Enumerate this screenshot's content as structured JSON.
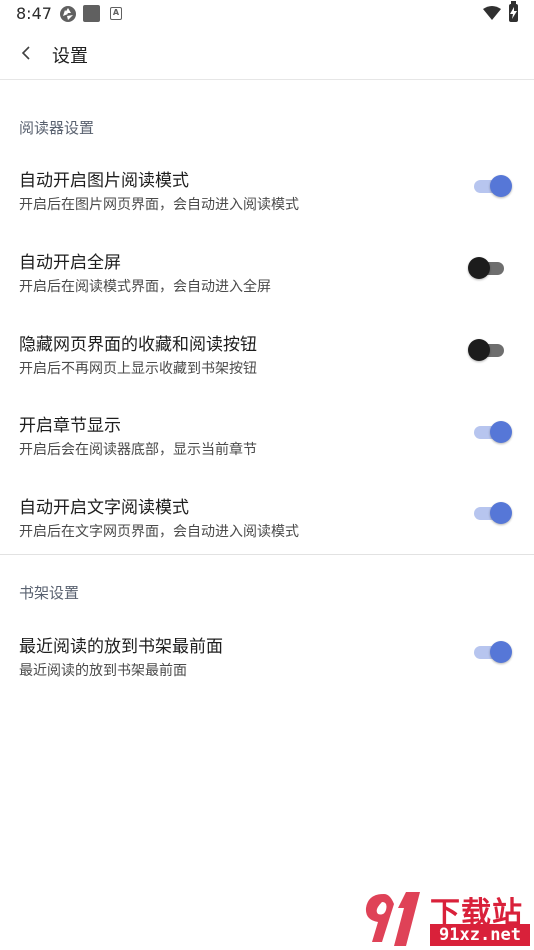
{
  "status_bar": {
    "time": "8:47",
    "icons": [
      "aperture-icon",
      "square-icon",
      "a-box-icon",
      "wifi-icon",
      "battery-charging-icon"
    ]
  },
  "top_bar": {
    "back_icon": "chevron-left-icon",
    "title": "设置"
  },
  "sections": [
    {
      "header": "阅读器设置",
      "items": [
        {
          "title": "自动开启图片阅读模式",
          "desc": "开启后在图片网页界面，会自动进入阅读模式",
          "enabled": true
        },
        {
          "title": "自动开启全屏",
          "desc": "开启后在阅读模式界面，会自动进入全屏",
          "enabled": false
        },
        {
          "title": "隐藏网页界面的收藏和阅读按钮",
          "desc": "开启后不再网页上显示收藏到书架按钮",
          "enabled": false
        },
        {
          "title": "开启章节显示",
          "desc": "开启后会在阅读器底部，显示当前章节",
          "enabled": true
        },
        {
          "title": "自动开启文字阅读模式",
          "desc": "开启后在文字网页界面，会自动进入阅读模式",
          "enabled": true
        }
      ]
    },
    {
      "header": "书架设置",
      "items": [
        {
          "title": "最近阅读的放到书架最前面",
          "desc": "最近阅读的放到书架最前面",
          "enabled": true
        }
      ]
    }
  ],
  "watermark": {
    "text": "下载站",
    "url": "91xz.net"
  },
  "colors": {
    "accent": "#5677d7",
    "accent_track": "#b7c5ef",
    "off_thumb": "#1c1c1c",
    "watermark": "#d9213a"
  }
}
